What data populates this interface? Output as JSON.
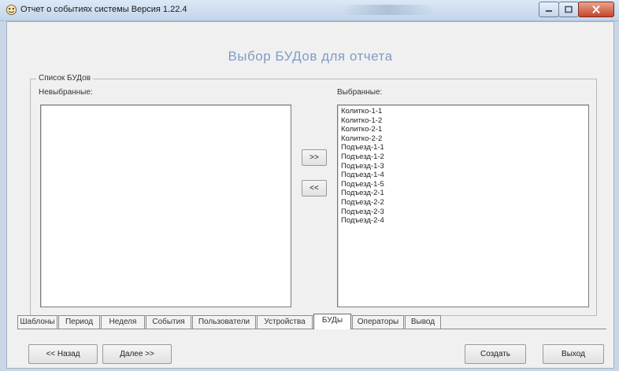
{
  "window": {
    "title": "Отчет о событиях системы  Версия 1.22.4",
    "controls": {
      "minimize": "minimize-icon",
      "maximize": "maximize-icon",
      "close": "close-icon"
    }
  },
  "header": {
    "title": "Выбор БУДов для отчета"
  },
  "group": {
    "legend": "Список БУДов"
  },
  "lists": {
    "unselected": {
      "label": "Невыбранные:",
      "items": []
    },
    "selected": {
      "label": "Выбранные:",
      "items": [
        "Колитко-1-1",
        "Колитко-1-2",
        "Колитко-2-1",
        "Колитко-2-2",
        "Подъезд-1-1",
        "Подъезд-1-2",
        "Подъезд-1-3",
        "Подъезд-1-4",
        "Подъезд-1-5",
        "Подъезд-2-1",
        "Подъезд-2-2",
        "Подъезд-2-3",
        "Подъезд-2-4"
      ]
    }
  },
  "transfer": {
    "add": ">>",
    "remove": "<<"
  },
  "tabs": [
    {
      "label": "Шаблоны",
      "active": false
    },
    {
      "label": "Период",
      "active": false
    },
    {
      "label": "Неделя",
      "active": false
    },
    {
      "label": "События",
      "active": false
    },
    {
      "label": "Пользователи",
      "active": false
    },
    {
      "label": "Устройства",
      "active": false
    },
    {
      "label": "БУДы",
      "active": true
    },
    {
      "label": "Операторы",
      "active": false
    },
    {
      "label": "Вывод",
      "active": false
    }
  ],
  "nav": {
    "back": "<< Назад",
    "next": "Далее >>",
    "create": "Создать",
    "exit": "Выход"
  }
}
